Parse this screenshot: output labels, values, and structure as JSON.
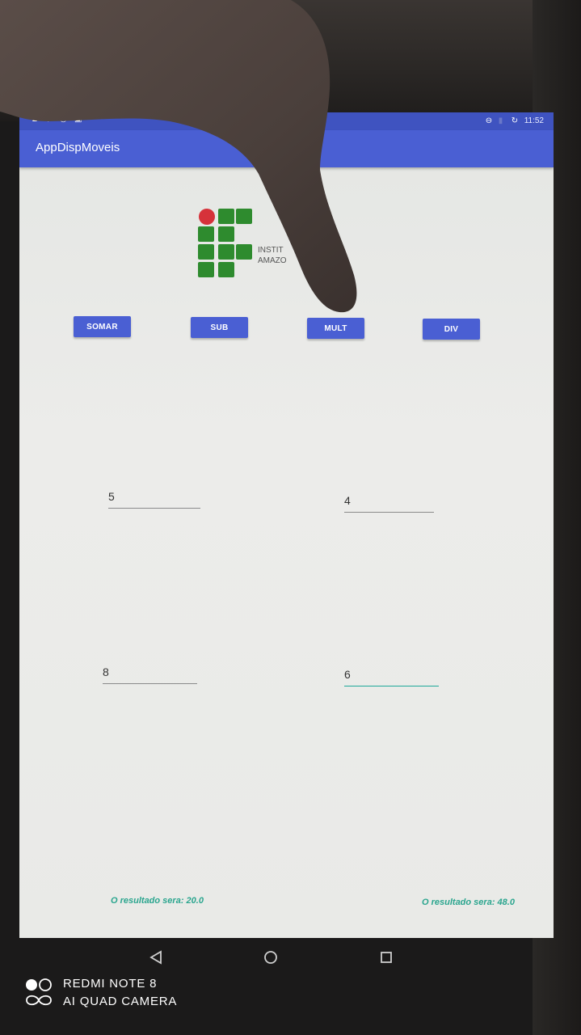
{
  "status_bar": {
    "time": "11:52",
    "left_icons": [
      "warning-icon",
      "shield-icon",
      "record-icon",
      "text-icon"
    ],
    "right_icons": [
      "minus-circle-icon",
      "battery-icon",
      "rotate-icon"
    ]
  },
  "app_bar": {
    "title": "AppDispMoveis"
  },
  "logo": {
    "line1": "INSTIT",
    "line2": "AMAZO",
    "colors": {
      "red": "#d6323a",
      "green": "#2e8b2e"
    }
  },
  "buttons": {
    "add": "SOMAR",
    "sub": "SUB",
    "mult": "MULT",
    "div": "DIV"
  },
  "fields": {
    "a": "5",
    "b": "4",
    "c": "8",
    "d": "6"
  },
  "results": {
    "left": "O resultado sera: 20.0",
    "right": "O resultado sera: 48.0"
  },
  "nav_bar": {
    "icons": [
      "back-icon",
      "home-icon",
      "recents-icon"
    ]
  },
  "watermark": {
    "line1": "REDMI NOTE 8",
    "line2": "AI QUAD CAMERA"
  },
  "colors": {
    "primary": "#4a5fd3",
    "primary_dark": "#3f53c0",
    "accent": "#1ea99a",
    "result_text": "#2aa58e"
  }
}
